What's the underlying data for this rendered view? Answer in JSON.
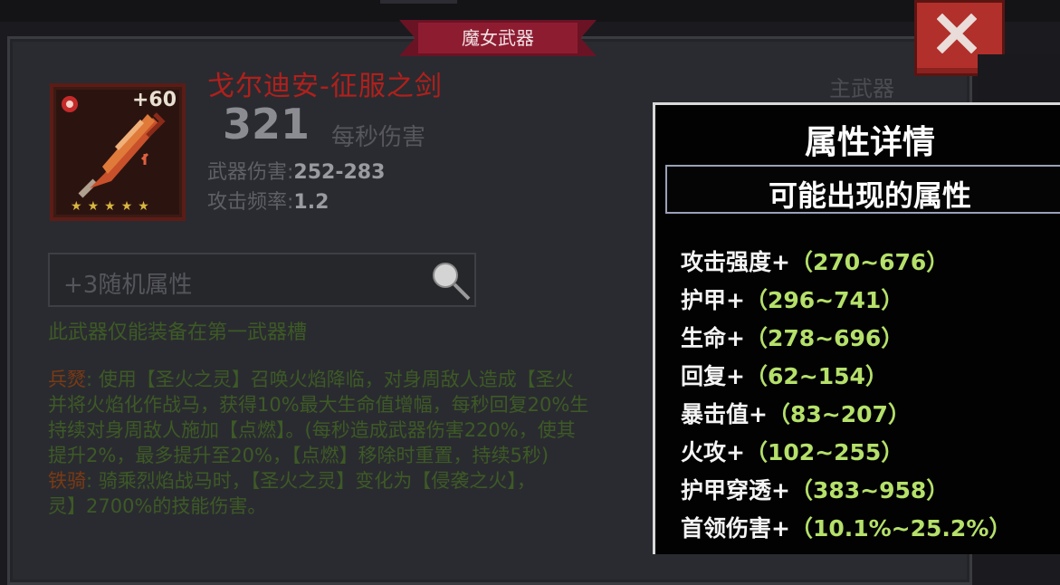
{
  "panel_tag": "魔女武器",
  "weapon": {
    "name": "戈尔迪安-征服之剑",
    "enhance": "+60",
    "stars": [
      "★",
      "★",
      "★",
      "★",
      "★"
    ],
    "dps": "321",
    "dps_label": "每秒伤害",
    "damage_label": "武器伤害:",
    "damage_value": "252-283",
    "rate_label": "攻击频率:",
    "rate_value": "1.2",
    "slot": "主武器"
  },
  "search": {
    "placeholder": "+3随机属性"
  },
  "note": "此武器仅能装备在第一武器槽",
  "desc_lines": [
    {
      "key": "兵燹",
      "text": ": 使用【圣火之灵】召唤火焰降临，对身周敌人造成【圣火"
    },
    {
      "key": "",
      "text": "并将火焰化作战马，获得10%最大生命值增幅，每秒回复20%生"
    },
    {
      "key": "",
      "text": "持续对身周敌人施加【点燃】。(每秒造成武器伤害220%，使其"
    },
    {
      "key": "",
      "text": "提升2%，最多提升至20%，【点燃】移除时重置，持续5秒)"
    },
    {
      "key": "铁骑",
      "text": ": 骑乘烈焰战马时，【圣火之灵】变化为【侵袭之火】，"
    },
    {
      "key": "",
      "text": "灵】2700%的技能伤害。"
    }
  ],
  "details": {
    "title": "属性详情",
    "subtitle": "可能出现的属性",
    "attributes": [
      {
        "name": "攻击强度+",
        "range": "（270~676）"
      },
      {
        "name": "护甲+",
        "range": "（296~741）"
      },
      {
        "name": "生命+",
        "range": "（278~696）"
      },
      {
        "name": "回复+",
        "range": "（62~154）"
      },
      {
        "name": "暴击值+",
        "range": "（83~207）"
      },
      {
        "name": "火攻+",
        "range": "（102~255）"
      },
      {
        "name": "护甲穿透+",
        "range": "（383~958）"
      },
      {
        "name": "首领伤害+",
        "range": "（10.1%~25.2%）"
      }
    ]
  },
  "colors": {
    "accent_red": "#b0201c",
    "attr_green": "#b5e06a",
    "close_red": "#b2302b"
  }
}
